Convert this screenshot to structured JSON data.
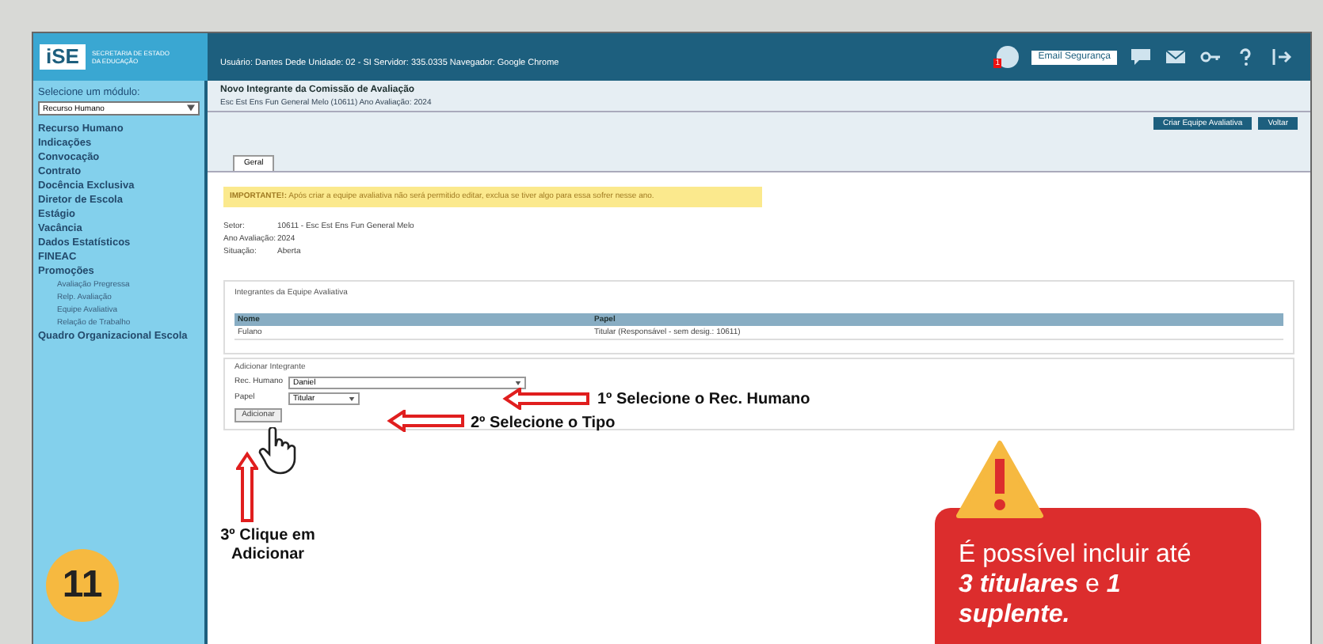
{
  "step_badge": "11",
  "header": {
    "logo": "iSE",
    "logo_caption": "SECRETARIA DE ESTADO DA EDUCAÇÃO",
    "user_info": "Usuário: Dantes Dede Unidade: 02 - SI Servidor: 335.0335 Navegador: Google Chrome",
    "security_button": "Email Segurança",
    "alert_count": "1"
  },
  "sidebar": {
    "module_label": "Selecione um módulo:",
    "module_value": "Recurso Humano",
    "items": [
      {
        "label": "Recurso Humano"
      },
      {
        "label": "Indicações"
      },
      {
        "label": "Convocação"
      },
      {
        "label": "Contrato"
      },
      {
        "label": "Docência Exclusiva"
      },
      {
        "label": "Diretor de Escola"
      },
      {
        "label": "Estágio"
      },
      {
        "label": "Vacância"
      },
      {
        "label": "Dados Estatísticos"
      },
      {
        "label": "FINEAC"
      },
      {
        "label": "Promoções",
        "children": [
          {
            "label": "Avaliação Pregressa"
          },
          {
            "label": "Relp. Avaliação"
          },
          {
            "label": "Equipe Avaliativa"
          },
          {
            "label": "Relação de Trabalho"
          }
        ]
      },
      {
        "label": "Quadro Organizacional Escola"
      }
    ]
  },
  "page": {
    "title": "Novo Integrante da Comissão de Avaliação",
    "subtitle": "Esc Est Ens Fun General Melo (10611) Ano Avaliação: 2024",
    "actions": [
      "Criar Equipe Avaliativa",
      "Voltar"
    ],
    "tabs": [
      {
        "label": "Geral",
        "selected": true
      }
    ],
    "warning": "**IMPORTANTE!:** Após criar a equipe avaliativa não será permitido editar, exclua se tiver algo para essa sofrer nesse ano.",
    "info": [
      {
        "label": "Setor:",
        "value": "10611 - Esc Est Ens Fun General Melo"
      },
      {
        "label": "Ano Avaliação:",
        "value": "2024"
      },
      {
        "label": "Situação:",
        "value": "Aberta"
      }
    ],
    "members": {
      "legend": "Integrantes da Equipe Avaliativa",
      "columns": [
        "Nome",
        "Papel"
      ],
      "rows": [
        [
          "Fulano",
          "Titular (Responsável - sem desig.: 10611)"
        ]
      ]
    },
    "add": {
      "legend": "Adicionar Integrante",
      "fields": [
        {
          "label": "Rec. Humano",
          "value": "Daniel"
        },
        {
          "label": "Papel",
          "value": "Titular"
        }
      ],
      "button": "Adicionar"
    }
  },
  "annotations": {
    "steps": [
      "1º Selecione o Rec. Humano",
      "2º Selecione o Tipo",
      "3º Clique em Adicionar"
    ],
    "callout": "É possível incluir até **3 titulares** e **1 suplente.**"
  }
}
